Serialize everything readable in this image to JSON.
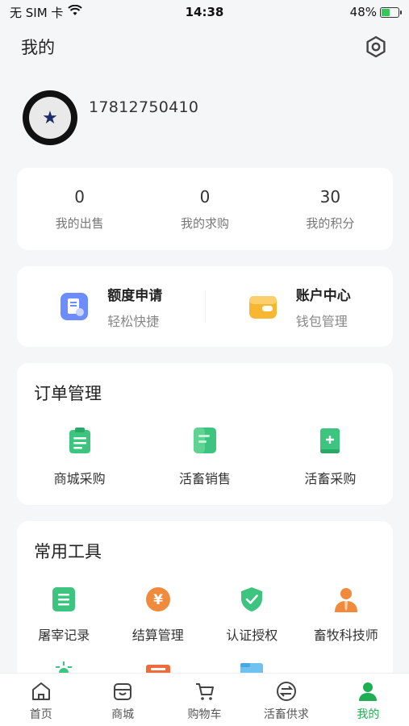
{
  "status_bar": {
    "carrier": "无 SIM 卡",
    "time": "14:38",
    "battery": "48%",
    "battery_level": 0.48
  },
  "header": {
    "title": "我的",
    "settings_icon": "gear-icon"
  },
  "profile": {
    "phone": "17812750410",
    "avatar_icon": "star-logo-icon"
  },
  "stats": [
    {
      "value": "0",
      "label": "我的出售"
    },
    {
      "value": "0",
      "label": "我的求购"
    },
    {
      "value": "30",
      "label": "我的积分"
    }
  ],
  "services": [
    {
      "title": "额度申请",
      "subtitle": "轻松快捷",
      "icon": "document-icon",
      "color": "#6c8cff"
    },
    {
      "title": "账户中心",
      "subtitle": "钱包管理",
      "icon": "wallet-icon",
      "color": "#f7b731"
    }
  ],
  "orders": {
    "title": "订单管理",
    "items": [
      {
        "label": "商城采购",
        "icon": "clipboard-icon"
      },
      {
        "label": "活畜销售",
        "icon": "receipt-icon"
      },
      {
        "label": "活畜采购",
        "icon": "scroll-icon"
      }
    ]
  },
  "tools": {
    "title": "常用工具",
    "items": [
      {
        "label": "屠宰记录",
        "icon": "list-icon"
      },
      {
        "label": "结算管理",
        "icon": "yen-icon"
      },
      {
        "label": "认证授权",
        "icon": "shield-check-icon"
      },
      {
        "label": "畜牧科技师",
        "icon": "technician-icon"
      }
    ]
  },
  "tabbar": {
    "items": [
      {
        "label": "首页",
        "icon": "home-icon"
      },
      {
        "label": "商城",
        "icon": "store-icon"
      },
      {
        "label": "购物车",
        "icon": "cart-icon"
      },
      {
        "label": "活畜供求",
        "icon": "exchange-icon"
      },
      {
        "label": "我的",
        "icon": "user-icon",
        "active": true
      }
    ]
  },
  "colors": {
    "accent": "#1fae54",
    "green_icon": "#3dc47e",
    "orange_icon": "#f08a3c"
  }
}
